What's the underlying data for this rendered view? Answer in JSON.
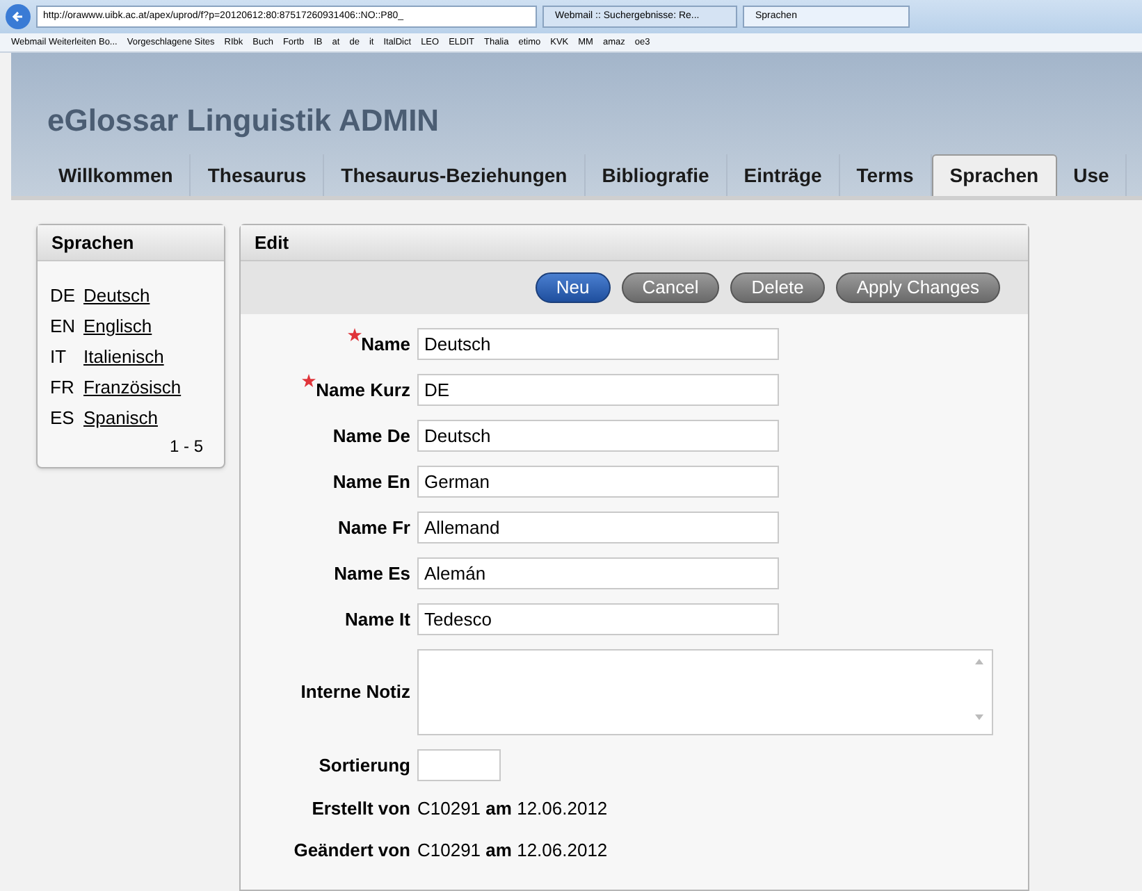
{
  "browser": {
    "url": "http://orawww.uibk.ac.at/apex/uprod/f?p=20120612:80:87517260931406::NO::P80_",
    "tabs": [
      {
        "label": "Webmail :: Suchergebnisse: Re...",
        "selected": false
      },
      {
        "label": "Sprachen",
        "selected": true
      }
    ],
    "favorites": [
      "Webmail Weiterleiten Bo...",
      "Vorgeschlagene Sites",
      "RIbk",
      "Buch",
      "Fortb",
      "IB",
      "at",
      "de",
      "it",
      "ItalDict",
      "LEO",
      "ELDIT",
      "Thalia",
      "etimo",
      "KVK",
      "MM",
      "amaz",
      "oe3"
    ]
  },
  "app_title": "eGlossar Linguistik ADMIN",
  "tabs": [
    {
      "label": "Willkommen",
      "selected": false
    },
    {
      "label": "Thesaurus",
      "selected": false
    },
    {
      "label": "Thesaurus-Beziehungen",
      "selected": false
    },
    {
      "label": "Bibliografie",
      "selected": false
    },
    {
      "label": "Einträge",
      "selected": false
    },
    {
      "label": "Terms",
      "selected": false
    },
    {
      "label": "Sprachen",
      "selected": true
    },
    {
      "label": "Use",
      "selected": false
    }
  ],
  "sidebar": {
    "title": "Sprachen",
    "items": [
      {
        "code": "DE",
        "name": "Deutsch"
      },
      {
        "code": "EN",
        "name": "Englisch"
      },
      {
        "code": "IT",
        "name": "Italienisch"
      },
      {
        "code": "FR",
        "name": "Französisch"
      },
      {
        "code": "ES",
        "name": "Spanisch"
      }
    ],
    "pagination": "1 - 5"
  },
  "edit": {
    "title": "Edit",
    "buttons": [
      {
        "label": "Neu",
        "kind": "primary"
      },
      {
        "label": "Cancel",
        "kind": "secondary"
      },
      {
        "label": "Delete",
        "kind": "secondary"
      },
      {
        "label": "Apply Changes",
        "kind": "secondary"
      }
    ],
    "fields": [
      {
        "label": "Name",
        "required": true,
        "kind": "text",
        "value": "Deutsch"
      },
      {
        "label": "Name Kurz",
        "required": true,
        "kind": "text",
        "value": "DE"
      },
      {
        "label": "Name De",
        "required": false,
        "kind": "text",
        "value": "Deutsch"
      },
      {
        "label": "Name En",
        "required": false,
        "kind": "text",
        "value": "German"
      },
      {
        "label": "Name Fr",
        "required": false,
        "kind": "text",
        "value": "Allemand"
      },
      {
        "label": "Name Es",
        "required": false,
        "kind": "text",
        "value": "Alemán"
      },
      {
        "label": "Name It",
        "required": false,
        "kind": "text",
        "value": "Tedesco"
      },
      {
        "label": "Interne Notiz",
        "required": false,
        "kind": "textarea"
      },
      {
        "label": "Sortierung",
        "required": false,
        "kind": "short"
      }
    ],
    "audit": [
      {
        "label": "Erstellt von",
        "user": "C10291",
        "word": "am",
        "date": "12.06.2012"
      },
      {
        "label": "Geändert von",
        "user": "C10291",
        "word": "am",
        "date": "12.06.2012"
      }
    ]
  }
}
